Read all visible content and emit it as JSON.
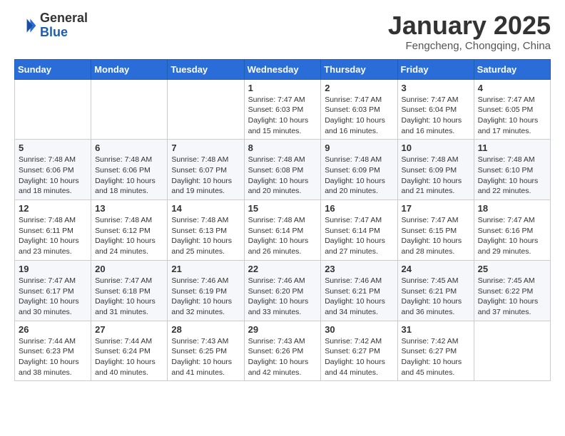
{
  "header": {
    "logo_general": "General",
    "logo_blue": "Blue",
    "month_title": "January 2025",
    "subtitle": "Fengcheng, Chongqing, China"
  },
  "weekdays": [
    "Sunday",
    "Monday",
    "Tuesday",
    "Wednesday",
    "Thursday",
    "Friday",
    "Saturday"
  ],
  "weeks": [
    [
      {
        "day": "",
        "info": ""
      },
      {
        "day": "",
        "info": ""
      },
      {
        "day": "",
        "info": ""
      },
      {
        "day": "1",
        "info": "Sunrise: 7:47 AM\nSunset: 6:03 PM\nDaylight: 10 hours and 15 minutes."
      },
      {
        "day": "2",
        "info": "Sunrise: 7:47 AM\nSunset: 6:03 PM\nDaylight: 10 hours and 16 minutes."
      },
      {
        "day": "3",
        "info": "Sunrise: 7:47 AM\nSunset: 6:04 PM\nDaylight: 10 hours and 16 minutes."
      },
      {
        "day": "4",
        "info": "Sunrise: 7:47 AM\nSunset: 6:05 PM\nDaylight: 10 hours and 17 minutes."
      }
    ],
    [
      {
        "day": "5",
        "info": "Sunrise: 7:48 AM\nSunset: 6:06 PM\nDaylight: 10 hours and 18 minutes."
      },
      {
        "day": "6",
        "info": "Sunrise: 7:48 AM\nSunset: 6:06 PM\nDaylight: 10 hours and 18 minutes."
      },
      {
        "day": "7",
        "info": "Sunrise: 7:48 AM\nSunset: 6:07 PM\nDaylight: 10 hours and 19 minutes."
      },
      {
        "day": "8",
        "info": "Sunrise: 7:48 AM\nSunset: 6:08 PM\nDaylight: 10 hours and 20 minutes."
      },
      {
        "day": "9",
        "info": "Sunrise: 7:48 AM\nSunset: 6:09 PM\nDaylight: 10 hours and 20 minutes."
      },
      {
        "day": "10",
        "info": "Sunrise: 7:48 AM\nSunset: 6:09 PM\nDaylight: 10 hours and 21 minutes."
      },
      {
        "day": "11",
        "info": "Sunrise: 7:48 AM\nSunset: 6:10 PM\nDaylight: 10 hours and 22 minutes."
      }
    ],
    [
      {
        "day": "12",
        "info": "Sunrise: 7:48 AM\nSunset: 6:11 PM\nDaylight: 10 hours and 23 minutes."
      },
      {
        "day": "13",
        "info": "Sunrise: 7:48 AM\nSunset: 6:12 PM\nDaylight: 10 hours and 24 minutes."
      },
      {
        "day": "14",
        "info": "Sunrise: 7:48 AM\nSunset: 6:13 PM\nDaylight: 10 hours and 25 minutes."
      },
      {
        "day": "15",
        "info": "Sunrise: 7:48 AM\nSunset: 6:14 PM\nDaylight: 10 hours and 26 minutes."
      },
      {
        "day": "16",
        "info": "Sunrise: 7:47 AM\nSunset: 6:14 PM\nDaylight: 10 hours and 27 minutes."
      },
      {
        "day": "17",
        "info": "Sunrise: 7:47 AM\nSunset: 6:15 PM\nDaylight: 10 hours and 28 minutes."
      },
      {
        "day": "18",
        "info": "Sunrise: 7:47 AM\nSunset: 6:16 PM\nDaylight: 10 hours and 29 minutes."
      }
    ],
    [
      {
        "day": "19",
        "info": "Sunrise: 7:47 AM\nSunset: 6:17 PM\nDaylight: 10 hours and 30 minutes."
      },
      {
        "day": "20",
        "info": "Sunrise: 7:47 AM\nSunset: 6:18 PM\nDaylight: 10 hours and 31 minutes."
      },
      {
        "day": "21",
        "info": "Sunrise: 7:46 AM\nSunset: 6:19 PM\nDaylight: 10 hours and 32 minutes."
      },
      {
        "day": "22",
        "info": "Sunrise: 7:46 AM\nSunset: 6:20 PM\nDaylight: 10 hours and 33 minutes."
      },
      {
        "day": "23",
        "info": "Sunrise: 7:46 AM\nSunset: 6:21 PM\nDaylight: 10 hours and 34 minutes."
      },
      {
        "day": "24",
        "info": "Sunrise: 7:45 AM\nSunset: 6:21 PM\nDaylight: 10 hours and 36 minutes."
      },
      {
        "day": "25",
        "info": "Sunrise: 7:45 AM\nSunset: 6:22 PM\nDaylight: 10 hours and 37 minutes."
      }
    ],
    [
      {
        "day": "26",
        "info": "Sunrise: 7:44 AM\nSunset: 6:23 PM\nDaylight: 10 hours and 38 minutes."
      },
      {
        "day": "27",
        "info": "Sunrise: 7:44 AM\nSunset: 6:24 PM\nDaylight: 10 hours and 40 minutes."
      },
      {
        "day": "28",
        "info": "Sunrise: 7:43 AM\nSunset: 6:25 PM\nDaylight: 10 hours and 41 minutes."
      },
      {
        "day": "29",
        "info": "Sunrise: 7:43 AM\nSunset: 6:26 PM\nDaylight: 10 hours and 42 minutes."
      },
      {
        "day": "30",
        "info": "Sunrise: 7:42 AM\nSunset: 6:27 PM\nDaylight: 10 hours and 44 minutes."
      },
      {
        "day": "31",
        "info": "Sunrise: 7:42 AM\nSunset: 6:27 PM\nDaylight: 10 hours and 45 minutes."
      },
      {
        "day": "",
        "info": ""
      }
    ]
  ]
}
